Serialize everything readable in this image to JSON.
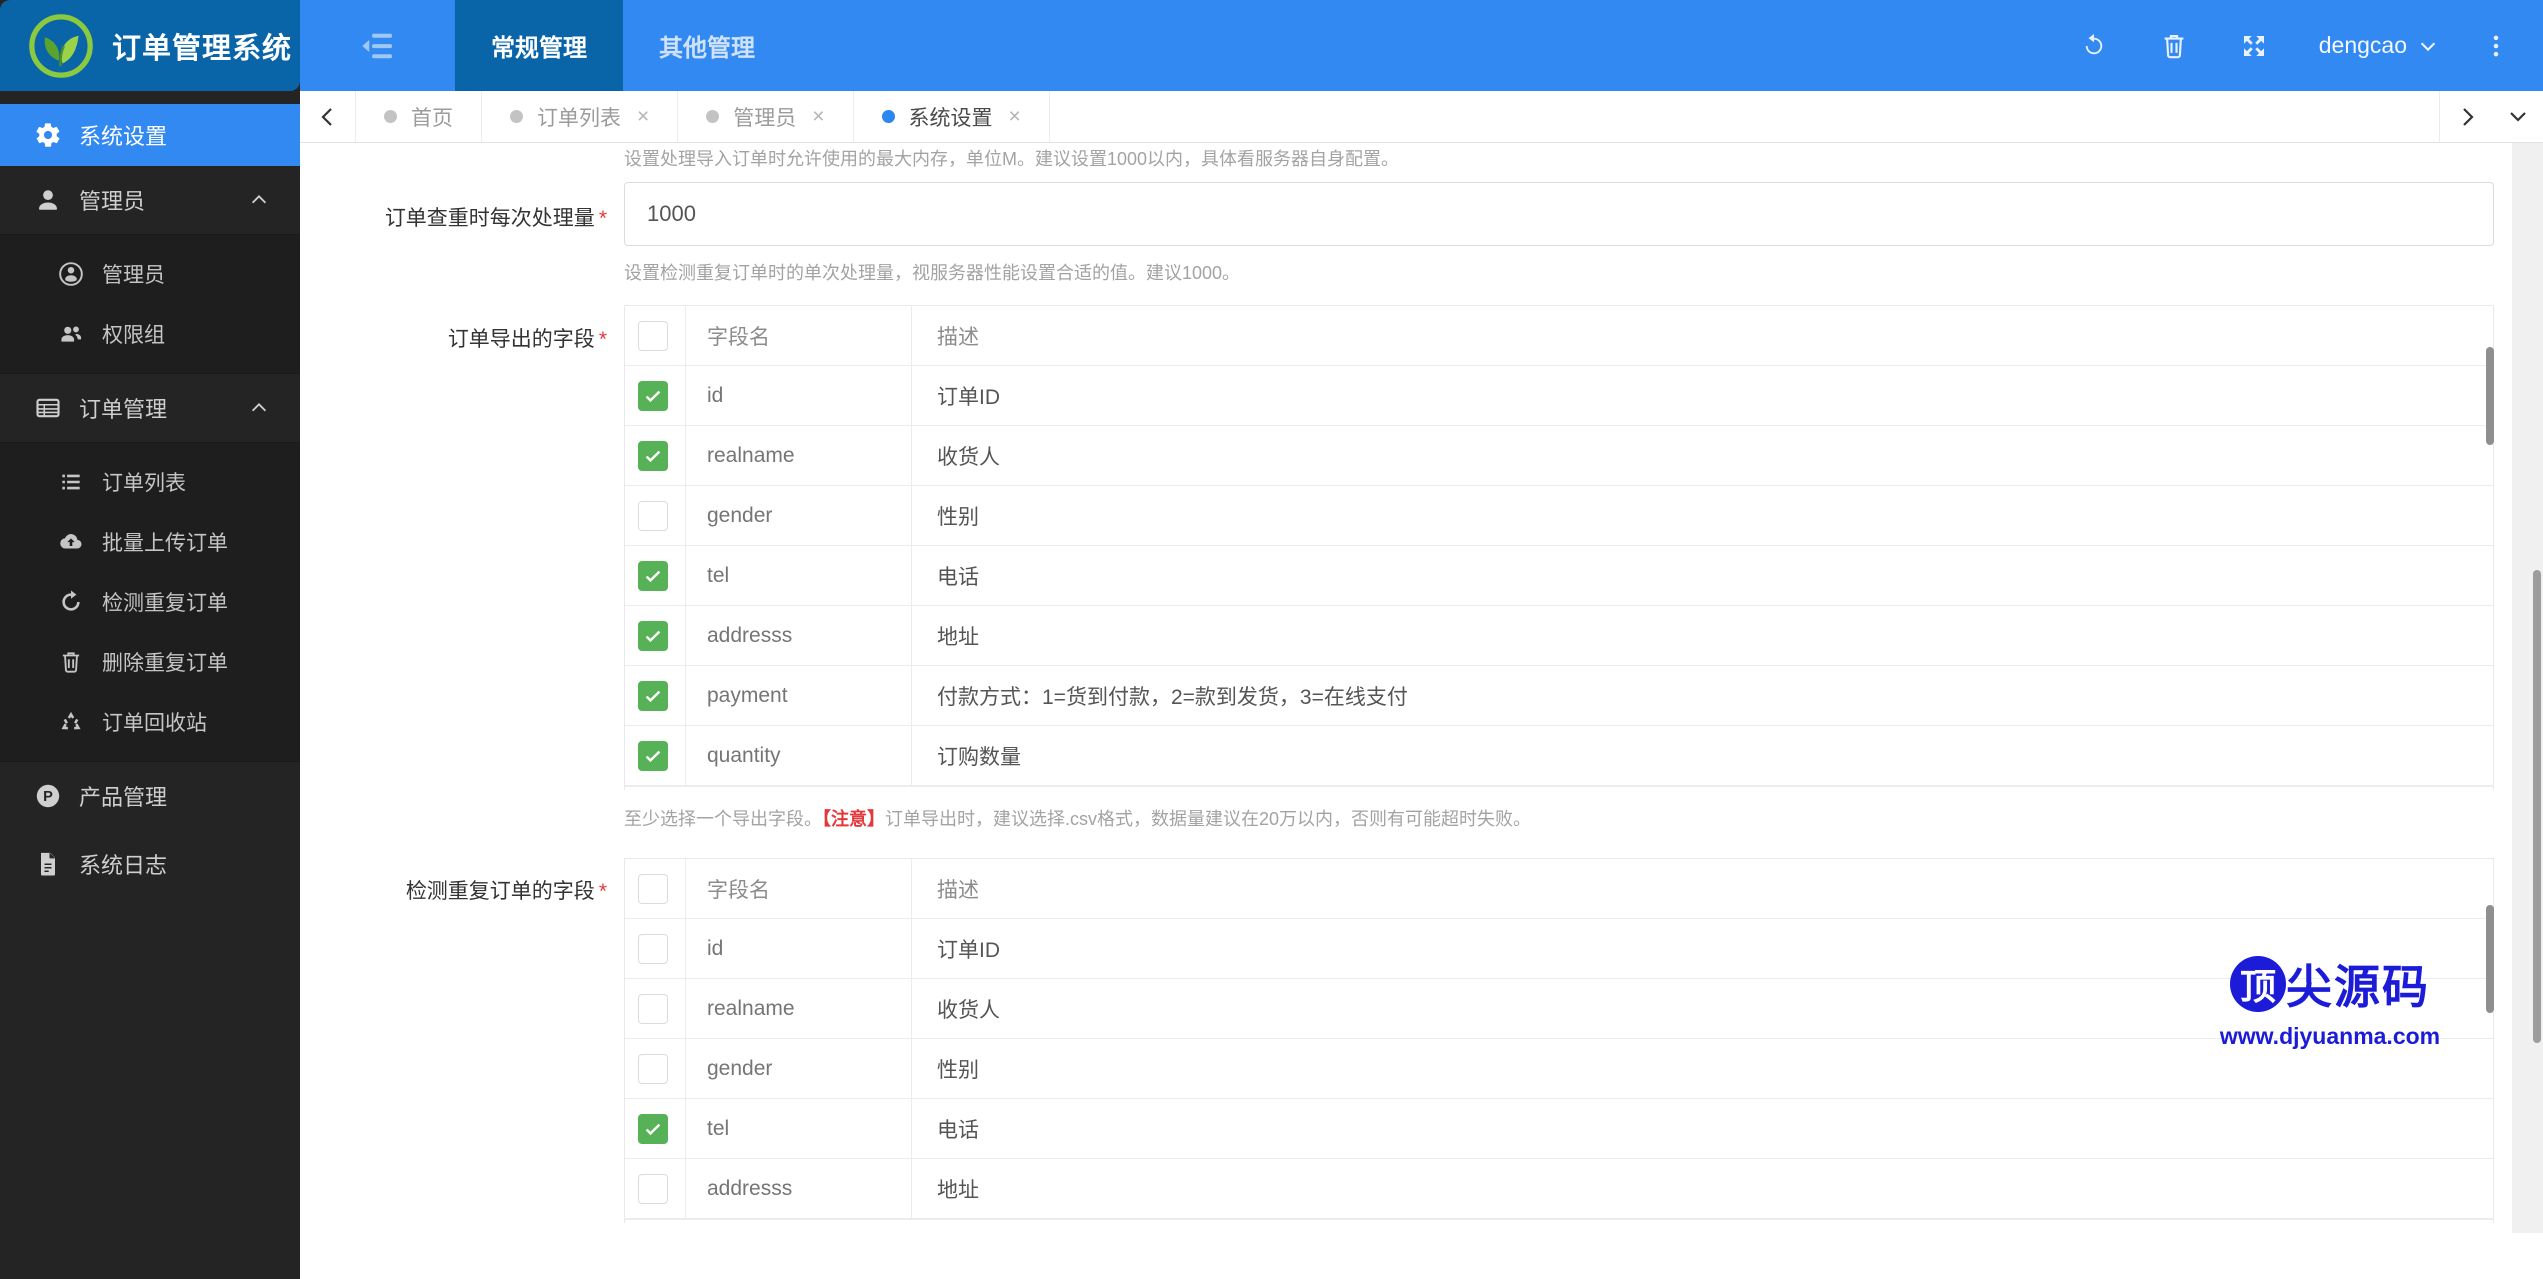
{
  "colors": {
    "header_blue": "#3389f2",
    "dark_blue": "#0a65a8",
    "sidebar_bg": "#242424",
    "active_blue": "#3389f2",
    "check_green": "#57b257",
    "warn_red": "#e4393c",
    "watermark_blue": "#1b1bd8"
  },
  "header": {
    "app_title": "订单管理系统",
    "menu_tabs": [
      {
        "label": "常规管理",
        "active": true
      },
      {
        "label": "其他管理",
        "active": false
      }
    ],
    "user": "dengcao"
  },
  "sidebar": {
    "items": [
      {
        "label": "系统设置",
        "icon": "cogs-icon",
        "active": true
      },
      {
        "label": "管理员",
        "icon": "user-icon",
        "expanded": true,
        "children": [
          {
            "label": "管理员",
            "icon": "user-circle-icon"
          },
          {
            "label": "权限组",
            "icon": "users-icon"
          }
        ]
      },
      {
        "label": "订单管理",
        "icon": "order-table-icon",
        "expanded": true,
        "children": [
          {
            "label": "订单列表",
            "icon": "list-icon"
          },
          {
            "label": "批量上传订单",
            "icon": "cloud-upload-icon"
          },
          {
            "label": "检测重复订单",
            "icon": "redo-icon"
          },
          {
            "label": "删除重复订单",
            "icon": "trash-icon"
          },
          {
            "label": "订单回收站",
            "icon": "recycle-icon"
          }
        ]
      },
      {
        "label": "产品管理",
        "icon": "product-icon"
      },
      {
        "label": "系统日志",
        "icon": "log-icon"
      }
    ]
  },
  "tabbar": {
    "tabs": [
      {
        "label": "首页",
        "active": false,
        "closable": false
      },
      {
        "label": "订单列表",
        "active": false,
        "closable": true
      },
      {
        "label": "管理员",
        "active": false,
        "closable": true
      },
      {
        "label": "系统设置",
        "active": true,
        "closable": true
      }
    ]
  },
  "form": {
    "top_help": "设置处理导入订单时允许使用的最大内存，单位M。建议设置1000以内，具体看服务器自身配置。",
    "batch_field": {
      "label": "订单查重时每次处理量",
      "required": "*",
      "value": "1000",
      "help": "设置检测重复订单时的单次处理量，视服务器性能设置合适的值。建议1000。"
    },
    "export_field": {
      "label": "订单导出的字段",
      "required": "*",
      "columns": [
        "字段名",
        "描述"
      ],
      "rows": [
        {
          "checked": true,
          "name": "id",
          "desc": "订单ID"
        },
        {
          "checked": true,
          "name": "realname",
          "desc": "收货人"
        },
        {
          "checked": false,
          "name": "gender",
          "desc": "性别"
        },
        {
          "checked": true,
          "name": "tel",
          "desc": "电话"
        },
        {
          "checked": true,
          "name": "addresss",
          "desc": "地址"
        },
        {
          "checked": true,
          "name": "payment",
          "desc": "付款方式：1=货到付款，2=款到发货，3=在线支付"
        },
        {
          "checked": true,
          "name": "quantity",
          "desc": "订购数量"
        }
      ],
      "help_prefix": "至少选择一个导出字段。",
      "help_warn": "【注意】",
      "help_suffix": "订单导出时，建议选择.csv格式，数据量建议在20万以内，否则有可能超时失败。"
    },
    "dup_field": {
      "label": "检测重复订单的字段",
      "required": "*",
      "columns": [
        "字段名",
        "描述"
      ],
      "rows": [
        {
          "checked": false,
          "name": "id",
          "desc": "订单ID"
        },
        {
          "checked": false,
          "name": "realname",
          "desc": "收货人"
        },
        {
          "checked": false,
          "name": "gender",
          "desc": "性别"
        },
        {
          "checked": true,
          "name": "tel",
          "desc": "电话"
        },
        {
          "checked": false,
          "name": "addresss",
          "desc": "地址"
        }
      ]
    }
  },
  "watermark": {
    "logo_text_first": "顶",
    "logo_text_rest": "尖源码",
    "url": "www.djyuanma.com"
  }
}
